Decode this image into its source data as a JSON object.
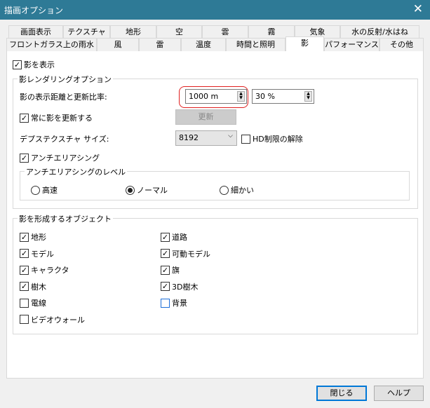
{
  "window": {
    "title": "描画オプション",
    "close": "✕"
  },
  "tabs_row1": [
    "画面表示",
    "テクスチャ",
    "地形",
    "空",
    "雲",
    "霧",
    "気象",
    "水の反射/水はね"
  ],
  "tabs_row2": [
    "フロントガラス上の雨水",
    "風",
    "雷",
    "温度",
    "時間と照明",
    "影",
    "パフォーマンス",
    "その他"
  ],
  "show_shadows": {
    "label": "影を表示",
    "checked": true
  },
  "rendering": {
    "legend": "影レンダリングオプション",
    "distance_label": "影の表示距離と更新比率:",
    "distance_value": "1000 m",
    "rate_value": "30 %",
    "always_update": {
      "label": "常に影を更新する",
      "checked": true
    },
    "update_button": "更新",
    "depth_label": "デプステクスチャ サイズ:",
    "depth_value": "8192",
    "hd_unlock": {
      "label": "HD制限の解除",
      "checked": false
    },
    "antialias": {
      "label": "アンチエリアシング",
      "checked": true
    },
    "aa_level": {
      "legend": "アンチエリアシングのレベル",
      "options": [
        "高速",
        "ノーマル",
        "細かい"
      ],
      "selected": "ノーマル"
    }
  },
  "objects": {
    "legend": "影を形成するオブジェクト",
    "items": [
      {
        "label": "地形",
        "checked": true
      },
      {
        "label": "道路",
        "checked": true
      },
      {
        "label": "モデル",
        "checked": true
      },
      {
        "label": "可動モデル",
        "checked": true
      },
      {
        "label": "キャラクタ",
        "checked": true
      },
      {
        "label": "旗",
        "checked": true
      },
      {
        "label": "樹木",
        "checked": true
      },
      {
        "label": "3D樹木",
        "checked": true
      },
      {
        "label": "電線",
        "checked": false
      },
      {
        "label": "背景",
        "checked": false
      },
      {
        "label": "ビデオウォール",
        "checked": false
      }
    ]
  },
  "footer": {
    "close": "閉じる",
    "help": "ヘルプ"
  },
  "colors": {
    "titlebar": "#2e7a96",
    "highlight": "#e02020"
  }
}
